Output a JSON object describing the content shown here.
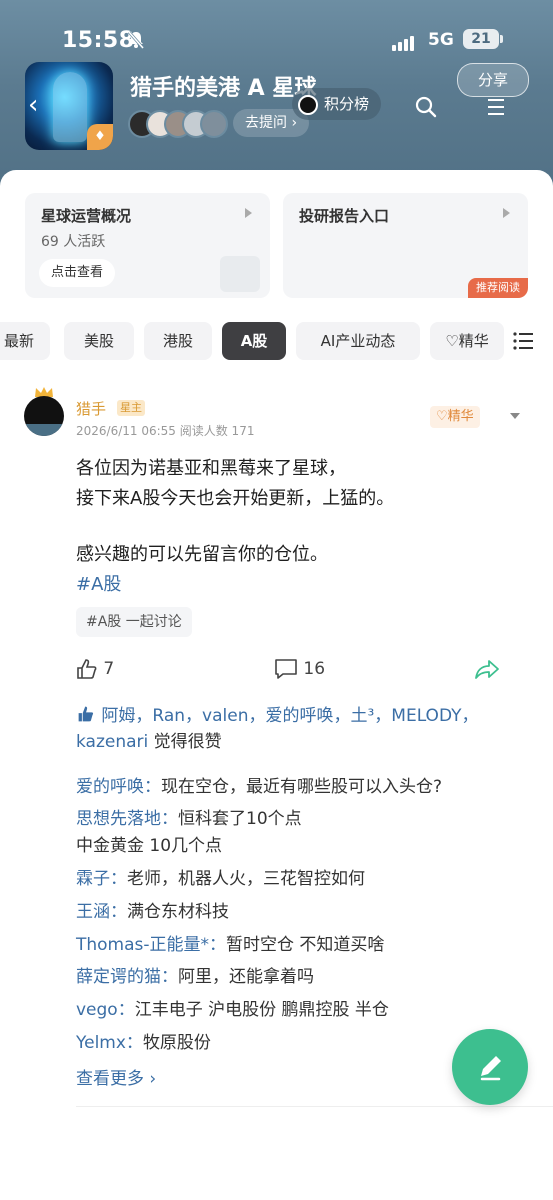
{
  "status_bar": {
    "time": "15:58",
    "network": "5G",
    "battery": "21"
  },
  "group": {
    "title": "猎手的美港 A 星球",
    "share_label": "分享",
    "rank_label": "积分榜",
    "ask_label": "去提问 ›"
  },
  "cards": [
    {
      "title": "星球运营概况",
      "subtitle": "69 人活跃",
      "button": "点击查看"
    },
    {
      "title": "投研报告入口",
      "tag": "推荐阅读"
    }
  ],
  "tabs": [
    "最新",
    "美股",
    "港股",
    "A股",
    "AI产业动态",
    "♡精华"
  ],
  "active_tab": "A股",
  "post": {
    "author": "猎手",
    "author_badge": "星主",
    "meta": "2026/6/11 06:55   阅读人数 171",
    "featured_label": "♡精华",
    "lines": [
      "各位因为诺基亚和黑莓来了星球，",
      "接下来A股今天也会开始更新，上猛的。",
      "",
      "感兴趣的可以先留言你的仓位。"
    ],
    "hashtag": "#A股",
    "topic_chip": "#A股 一起讨论",
    "like_count": "7",
    "comment_count": "16",
    "likers_names": "阿姆，Ran，valen，爱的呼唤，土³，MELODY，kazenari",
    "likers_suffix": " 觉得很赞",
    "comments": [
      {
        "user": "爱的呼唤：",
        "text": "现在空仓，最近有哪些股可以入头仓?"
      },
      {
        "user": "思想先落地：",
        "text": "恒科套了10个点"
      },
      {
        "user": "",
        "text": "中金黄金 10几个点"
      },
      {
        "user": "霖子：",
        "text": "老师，机器人火，三花智控如何"
      },
      {
        "user": "王涵：",
        "text": "满仓东材科技"
      },
      {
        "user": "Thomas-正能量*：",
        "text": "暂时空仓 不知道买啥"
      },
      {
        "user": "薛定谔的猫：",
        "text": "阿里，还能拿着吗"
      },
      {
        "user": "vego：",
        "text": "江丰电子 沪电股份 鹏鼎控股 半仓"
      },
      {
        "user": "Yelmx：",
        "text": "牧原股份"
      }
    ],
    "see_more": "查看更多 ›"
  },
  "colors": {
    "accent_green": "#3dbf8f",
    "link_blue": "#3b6ea5",
    "gold": "#d99a34"
  }
}
